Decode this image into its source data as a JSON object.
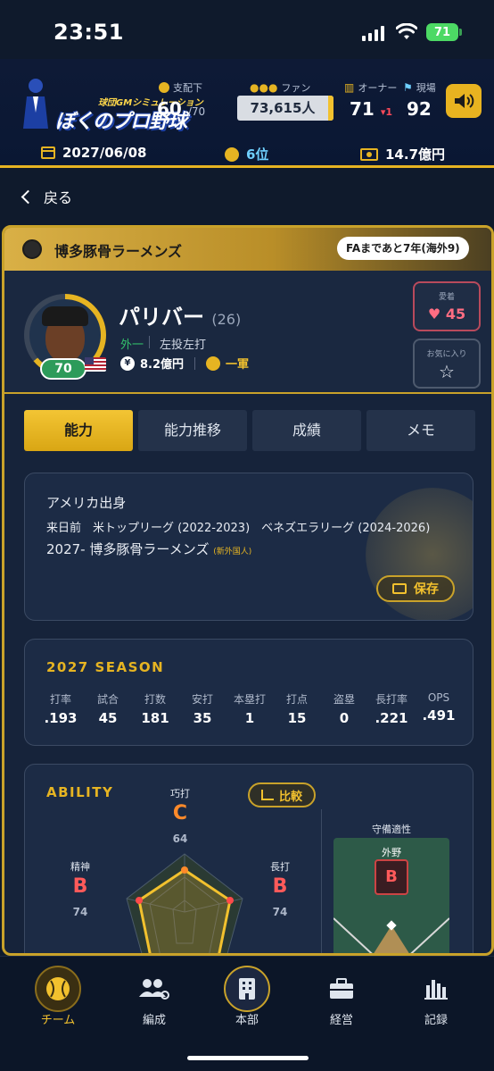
{
  "status_bar": {
    "time": "23:51",
    "battery": "71"
  },
  "header": {
    "logo": {
      "line1": "ぼくのプロ野球",
      "line2": "球団GMシミュレーション"
    },
    "control": {
      "label": "支配下",
      "value": "60",
      "max": "/70"
    },
    "fans": {
      "label": "ファン",
      "value": "73,615人"
    },
    "owner": {
      "label": "オーナー",
      "value": "71",
      "change": "▾1"
    },
    "field": {
      "label": "現場",
      "value": "92"
    },
    "date": "2027/06/08",
    "rank": "6位",
    "funds": "14.7億円"
  },
  "back_label": "戻る",
  "team": {
    "name": "博多豚骨ラーメンズ",
    "fa_text": "FAまであと7年(海外9)"
  },
  "player": {
    "name": "パリバー",
    "age": "(26)",
    "position": "外一",
    "handedness": "左投左打",
    "salary": "8.2億円",
    "roster": "一軍",
    "level": "70",
    "affection": {
      "label": "愛着",
      "value": "45"
    },
    "favorite_label": "お気に入り"
  },
  "tabs": [
    "能力",
    "能力推移",
    "成績",
    "メモ"
  ],
  "bio": {
    "origin": "アメリカ出身",
    "before_japan": "来日前　米トップリーグ (2022-2023)　ベネズエラリーグ (2024-2026)",
    "career_prefix": "2027- 博多豚骨ラーメンズ",
    "career_tag": "(新外国人)",
    "save_label": "保存"
  },
  "season": {
    "title": "2027 SEASON",
    "stats": [
      {
        "label": "打率",
        "value": ".193"
      },
      {
        "label": "試合",
        "value": "45"
      },
      {
        "label": "打数",
        "value": "181"
      },
      {
        "label": "安打",
        "value": "35"
      },
      {
        "label": "本塁打",
        "value": "1"
      },
      {
        "label": "打点",
        "value": "15"
      },
      {
        "label": "盗塁",
        "value": "0"
      },
      {
        "label": "長打率",
        "value": ".221"
      },
      {
        "label": "OPS",
        "value": ".491"
      }
    ]
  },
  "ability": {
    "title": "ABILITY",
    "compare_label": "比較",
    "contact": {
      "label": "巧打",
      "grade": "C",
      "value": "64"
    },
    "mental": {
      "label": "精神",
      "grade": "B",
      "value": "74"
    },
    "power": {
      "label": "長打",
      "grade": "B",
      "value": "74"
    },
    "defense_title": "守備適性",
    "defense_position": "外野",
    "defense_grade": "B"
  },
  "nav": [
    {
      "label": "チーム",
      "icon": "baseball-icon"
    },
    {
      "label": "編成",
      "icon": "people-gear-icon"
    },
    {
      "label": "本部",
      "icon": "building-icon"
    },
    {
      "label": "経営",
      "icon": "briefcase-icon"
    },
    {
      "label": "記録",
      "icon": "bar-chart-icon"
    }
  ],
  "colors": {
    "accent": "#e6b422",
    "background": "#0f1a2c",
    "green": "#2d9b5a",
    "grade_red": "#ff5a5a",
    "grade_orange": "#ff8a2a"
  }
}
